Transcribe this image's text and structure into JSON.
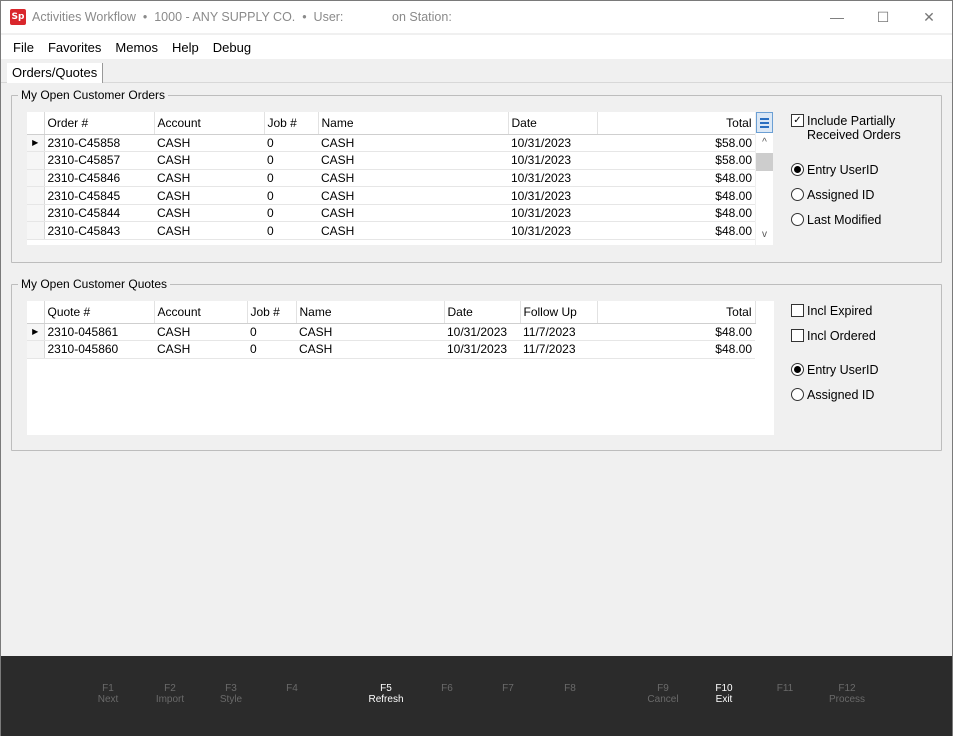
{
  "window": {
    "app_icon_text": "Sp",
    "title": "Activities Workflow  •  1000 - ANY SUPPLY CO.  •  User:              on Station:",
    "minimize": "—",
    "maximize": "☐",
    "close": "✕"
  },
  "menu": [
    "File",
    "Favorites",
    "Memos",
    "Help",
    "Debug"
  ],
  "tabs": [
    {
      "label": "Orders/Quotes",
      "active": true
    }
  ],
  "orders": {
    "group_title": "My Open Customer Orders",
    "columns": [
      "Order #",
      "Account",
      "Job #",
      "Name",
      "Date",
      "Total"
    ],
    "rows": [
      {
        "order": "2310-C45858",
        "account": "CASH",
        "job": "0",
        "name": "CASH",
        "date": "10/31/2023",
        "total": "$58.00",
        "current": true
      },
      {
        "order": "2310-C45857",
        "account": "CASH",
        "job": "0",
        "name": "CASH",
        "date": "10/31/2023",
        "total": "$58.00"
      },
      {
        "order": "2310-C45846",
        "account": "CASH",
        "job": "0",
        "name": "CASH",
        "date": "10/31/2023",
        "total": "$48.00"
      },
      {
        "order": "2310-C45845",
        "account": "CASH",
        "job": "0",
        "name": "CASH",
        "date": "10/31/2023",
        "total": "$48.00"
      },
      {
        "order": "2310-C45844",
        "account": "CASH",
        "job": "0",
        "name": "CASH",
        "date": "10/31/2023",
        "total": "$48.00"
      },
      {
        "order": "2310-C45843",
        "account": "CASH",
        "job": "0",
        "name": "CASH",
        "date": "10/31/2023",
        "total": "$48.00"
      }
    ],
    "options": {
      "include_partial": {
        "label_line1": "Include Partially",
        "label_line2": "Received Orders",
        "checked": true
      },
      "radios": [
        {
          "label": "Entry UserID",
          "checked": true
        },
        {
          "label": "Assigned ID",
          "checked": false
        },
        {
          "label": "Last Modified",
          "checked": false
        }
      ]
    }
  },
  "quotes": {
    "group_title": "My Open Customer Quotes",
    "columns": [
      "Quote #",
      "Account",
      "Job #",
      "Name",
      "Date",
      "Follow Up",
      "Total"
    ],
    "rows": [
      {
        "quote": "2310-045861",
        "account": "CASH",
        "job": "0",
        "name": "CASH",
        "date": "10/31/2023",
        "follow_up": "11/7/2023",
        "total": "$48.00",
        "current": true
      },
      {
        "quote": "2310-045860",
        "account": "CASH",
        "job": "0",
        "name": "CASH",
        "date": "10/31/2023",
        "follow_up": "11/7/2023",
        "total": "$48.00"
      }
    ],
    "options": {
      "checkboxes": [
        {
          "label": "Incl Expired",
          "checked": false
        },
        {
          "label": "Incl Ordered",
          "checked": false
        }
      ],
      "radios": [
        {
          "label": "Entry UserID",
          "checked": true
        },
        {
          "label": "Assigned ID",
          "checked": false
        }
      ]
    }
  },
  "function_keys": [
    {
      "key": "F1",
      "label": "Next",
      "enabled": false
    },
    {
      "key": "F2",
      "label": "Import",
      "enabled": false
    },
    {
      "key": "F3",
      "label": "Style",
      "enabled": false
    },
    {
      "key": "F4",
      "label": "",
      "enabled": false
    },
    {
      "key": "F5",
      "label": "Refresh",
      "enabled": true
    },
    {
      "key": "F6",
      "label": "",
      "enabled": false
    },
    {
      "key": "F7",
      "label": "",
      "enabled": false
    },
    {
      "key": "F8",
      "label": "",
      "enabled": false
    },
    {
      "key": "F9",
      "label": "Cancel",
      "enabled": false
    },
    {
      "key": "F10",
      "label": "Exit",
      "enabled": true
    },
    {
      "key": "F11",
      "label": "",
      "enabled": false
    },
    {
      "key": "F12",
      "label": "Process",
      "enabled": false
    }
  ],
  "icons": {
    "row_pointer": "▶",
    "scroll_up": "^",
    "scroll_down": "v",
    "check": "✓"
  }
}
